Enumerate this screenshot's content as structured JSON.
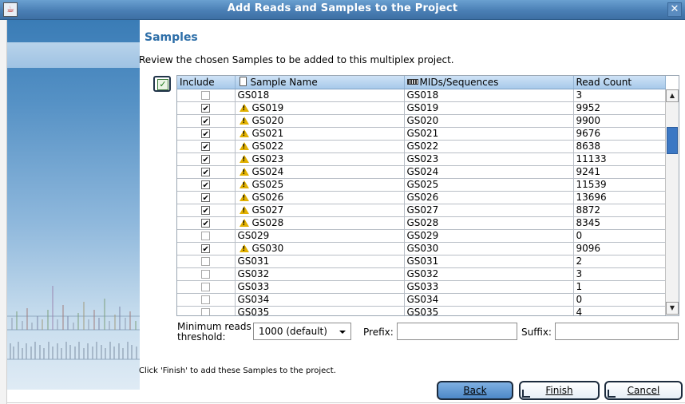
{
  "window": {
    "title": "Add Reads and Samples to the Project"
  },
  "section": {
    "title": "Samples",
    "description": "Review the chosen Samples to be added to this multiplex project."
  },
  "table": {
    "columns": {
      "include": "Include",
      "sample_name": "Sample Name",
      "mids": "MIDs/Sequences",
      "read_count": "Read Count"
    },
    "rows": [
      {
        "checked": false,
        "warn": false,
        "name": "GS018",
        "mid": "GS018",
        "count": "3"
      },
      {
        "checked": true,
        "warn": true,
        "name": "GS019",
        "mid": "GS019",
        "count": "9952"
      },
      {
        "checked": true,
        "warn": true,
        "name": "GS020",
        "mid": "GS020",
        "count": "9900"
      },
      {
        "checked": true,
        "warn": true,
        "name": "GS021",
        "mid": "GS021",
        "count": "9676"
      },
      {
        "checked": true,
        "warn": true,
        "name": "GS022",
        "mid": "GS022",
        "count": "8638"
      },
      {
        "checked": true,
        "warn": true,
        "name": "GS023",
        "mid": "GS023",
        "count": "11133"
      },
      {
        "checked": true,
        "warn": true,
        "name": "GS024",
        "mid": "GS024",
        "count": "9241"
      },
      {
        "checked": true,
        "warn": true,
        "name": "GS025",
        "mid": "GS025",
        "count": "11539"
      },
      {
        "checked": true,
        "warn": true,
        "name": "GS026",
        "mid": "GS026",
        "count": "13696"
      },
      {
        "checked": true,
        "warn": true,
        "name": "GS027",
        "mid": "GS027",
        "count": "8872"
      },
      {
        "checked": true,
        "warn": true,
        "name": "GS028",
        "mid": "GS028",
        "count": "8345"
      },
      {
        "checked": false,
        "warn": false,
        "name": "GS029",
        "mid": "GS029",
        "count": "0"
      },
      {
        "checked": true,
        "warn": true,
        "name": "GS030",
        "mid": "GS030",
        "count": "9096"
      },
      {
        "checked": false,
        "warn": false,
        "name": "GS031",
        "mid": "GS031",
        "count": "2"
      },
      {
        "checked": false,
        "warn": false,
        "name": "GS032",
        "mid": "GS032",
        "count": "3"
      },
      {
        "checked": false,
        "warn": false,
        "name": "GS033",
        "mid": "GS033",
        "count": "1"
      },
      {
        "checked": false,
        "warn": false,
        "name": "GS034",
        "mid": "GS034",
        "count": "0"
      },
      {
        "checked": false,
        "warn": false,
        "name": "GS035",
        "mid": "GS035",
        "count": "4"
      }
    ]
  },
  "options": {
    "threshold_label": "Minimum reads threshold:",
    "threshold_line1": "Minimum reads",
    "threshold_line2": "threshold:",
    "threshold_value": "1000 (default)",
    "prefix_label": "Prefix:",
    "prefix_value": "",
    "suffix_label": "Suffix:",
    "suffix_value": ""
  },
  "footer": {
    "instruction": "Click 'Finish' to add these Samples to the project.",
    "back_label": "Back",
    "finish_label": "Finish",
    "cancel_label": "Cancel"
  },
  "icons": {
    "app": "java-app-icon",
    "close": "close-icon",
    "warning": "warning-icon",
    "sample_column": "document-icon",
    "mids_column": "barcode-icon"
  },
  "colors": {
    "titlebar": "#4a7fb5",
    "section_title": "#2d6ea8",
    "table_header": "#a7c9ea",
    "scroll_thumb": "#3c78c4",
    "warning": "#e2b100"
  }
}
